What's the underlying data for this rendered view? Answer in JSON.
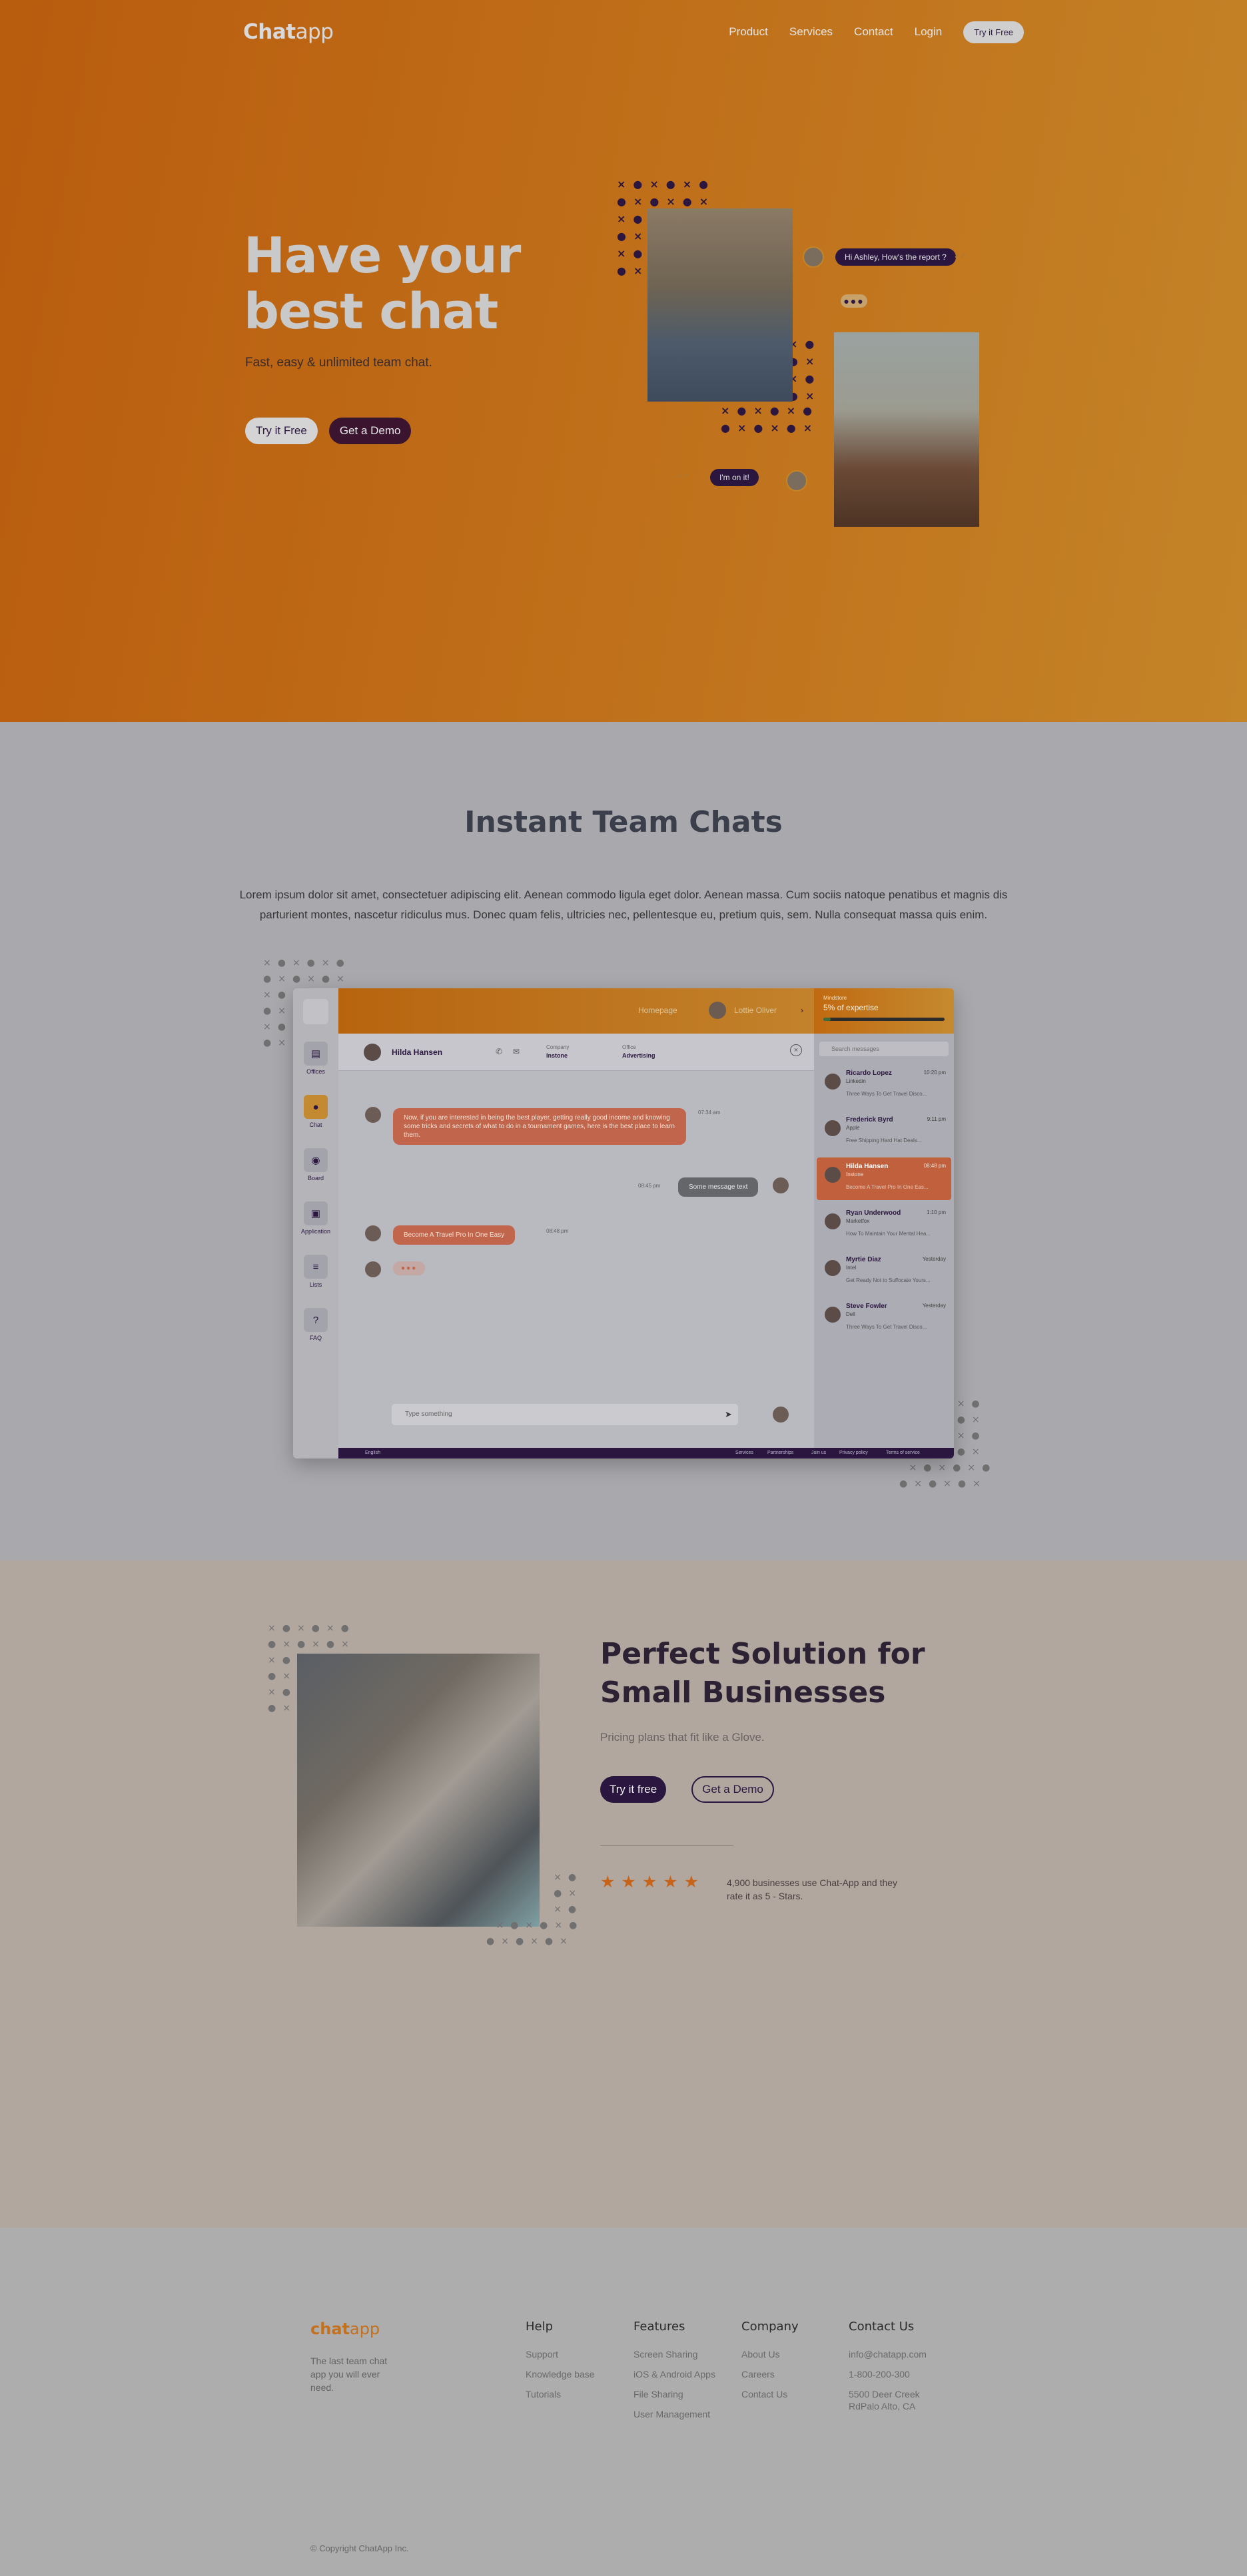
{
  "nav": {
    "logo_bold": "Chat",
    "logo_light": "app",
    "links": [
      "Product",
      "Services",
      "Contact",
      "Login"
    ],
    "cta": "Try it Free"
  },
  "hero": {
    "title": "Have your best chat",
    "subtitle": "Fast, easy & unlimited team chat.",
    "btn_primary": "Try it Free",
    "btn_secondary": "Get a Demo",
    "bubble_1": "Hi Ashley, How's the report ?",
    "bubble_2": "I'm on it!"
  },
  "team": {
    "title": "Instant Team Chats",
    "paragraph": "Lorem ipsum dolor sit amet, consectetuer adipiscing elit. Aenean commodo ligula eget dolor. Aenean massa. Cum sociis natoque penatibus et magnis dis parturient montes, nascetur ridiculus mus. Donec quam felis, ultricies nec, pellentesque eu, pretium quis, sem. Nulla consequat massa quis enim.",
    "app": {
      "sidebar": [
        {
          "label": "Offices",
          "icon": "briefcase-icon"
        },
        {
          "label": "Chat",
          "icon": "chat-icon"
        },
        {
          "label": "Board",
          "icon": "board-icon"
        },
        {
          "label": "Application",
          "icon": "application-icon"
        },
        {
          "label": "Lists",
          "icon": "list-icon"
        },
        {
          "label": "FAQ",
          "icon": "help-icon"
        }
      ],
      "topbar": {
        "homepage": "Homepage",
        "user": "Lottie Oliver"
      },
      "expertise": {
        "caption": "Mindstore",
        "value": "5% of expertise",
        "progress": 0.06
      },
      "chat_header": {
        "name": "Hilda Hansen",
        "company_label": "Company",
        "company": "Instone",
        "office_label": "Office",
        "office": "Advertising"
      },
      "messages": [
        {
          "text": "Now, if you are interested in being the best player, getting really good income and knowing some tricks and secrets of what to do in a tournament games, here is the best place to learn them.",
          "time": "07:34 am"
        },
        {
          "text": "Some message text",
          "time": "08:45 pm"
        },
        {
          "text": "Become A Travel Pro In One Easy",
          "time": "08:48 pm"
        }
      ],
      "input_placeholder": "Type something",
      "search_placeholder": "Search messages",
      "contacts": [
        {
          "name": "Ricardo Lopez",
          "role": "Linkedin",
          "time": "10:20 pm",
          "msg": "Three Ways To Get Travel Disco..."
        },
        {
          "name": "Frederick Byrd",
          "role": "Apple",
          "time": "9:11 pm",
          "msg": "Free Shipping Hard Hat Deals..."
        },
        {
          "name": "Hilda Hansen",
          "role": "Instone",
          "time": "08:48 pm",
          "msg": "Become A Travel Pro In One Eas..."
        },
        {
          "name": "Ryan Underwood",
          "role": "Marketfox",
          "time": "1:10 pm",
          "msg": "How To Maintain Your Mental Hea..."
        },
        {
          "name": "Myrtie Diaz",
          "role": "Intel",
          "time": "Yesterday",
          "msg": "Get Ready Not to Suffocate Yours..."
        },
        {
          "name": "Steve Fowler",
          "role": "Dell",
          "time": "Yesterday",
          "msg": "Three Ways To Get Travel Disco..."
        }
      ],
      "footer_lang": "English",
      "footer_links": [
        "Services",
        "Partnerships",
        "Join us",
        "Privacy policy",
        "Terms of service"
      ]
    }
  },
  "business": {
    "title": "Perfect Solution for Small Businesses",
    "subtitle": "Pricing plans that fit like a Glove.",
    "btn_primary": "Try it free",
    "btn_secondary": "Get a Demo",
    "stars": "★★★★★",
    "rating_note": "4,900 businesses use Chat-App and they rate it as 5 - Stars."
  },
  "footer": {
    "logo_bold": "chat",
    "logo_light": "app",
    "tagline": "The last team chat app you will ever need.",
    "columns": [
      {
        "title": "Help",
        "links": [
          "Support",
          "Knowledge base",
          "Tutorials"
        ]
      },
      {
        "title": "Features",
        "links": [
          "Screen Sharing",
          "iOS & Android Apps",
          "File Sharing",
          "User Management"
        ]
      },
      {
        "title": "Company",
        "links": [
          "About Us",
          "Careers",
          "Contact Us"
        ]
      },
      {
        "title": "Contact Us",
        "links": [
          "info@chatapp.com",
          "1-800-200-300",
          "5500 Deer Creek RdPalo Alto, CA"
        ]
      }
    ],
    "copyright": "© Copyright ChatApp Inc."
  },
  "colors": {
    "accent": "#c17421",
    "brand_dark": "#2b1640",
    "star": "#c7641a"
  }
}
